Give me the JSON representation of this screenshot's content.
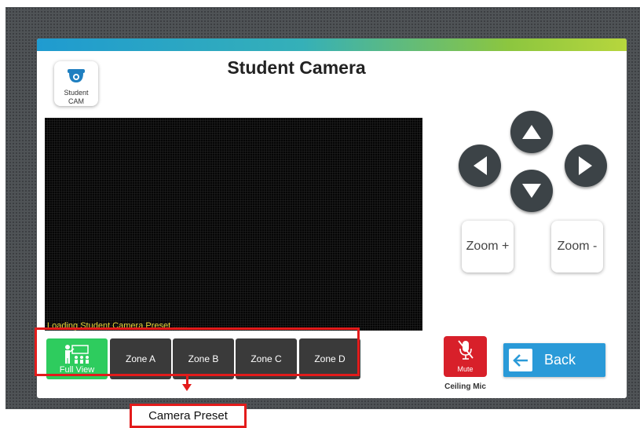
{
  "page": {
    "title": "Student Camera"
  },
  "camera_button": {
    "label_line1": "Student",
    "label_line2": "CAM",
    "icon": "security-camera-icon"
  },
  "video": {
    "status_text": "Loading Student Camera Preset ......"
  },
  "ptz": {
    "up_icon": "arrow-up-icon",
    "down_icon": "arrow-down-icon",
    "left_icon": "arrow-left-icon",
    "right_icon": "arrow-right-icon",
    "zoom_in_label": "Zoom +",
    "zoom_out_label": "Zoom -"
  },
  "presets": [
    {
      "label": "Full View",
      "active": true,
      "icon": "classroom-teacher-icon"
    },
    {
      "label": "Zone A",
      "active": false
    },
    {
      "label": "Zone B",
      "active": false
    },
    {
      "label": "Zone C",
      "active": false
    },
    {
      "label": "Zone D",
      "active": false
    }
  ],
  "mic": {
    "mute_label": "Mute",
    "caption": "Ceiling Mic",
    "icon": "mic-muted-icon"
  },
  "back": {
    "label": "Back",
    "icon": "back-arrow-icon"
  },
  "annotation": {
    "label": "Camera Preset"
  },
  "colors": {
    "accent_blue": "#2a9ad8",
    "preset_active": "#2ecc5e",
    "preset_inactive": "#3a3a3a",
    "mute_red": "#d8202a",
    "annotation_red": "#e31b1b",
    "status_text": "#e8d43a"
  }
}
